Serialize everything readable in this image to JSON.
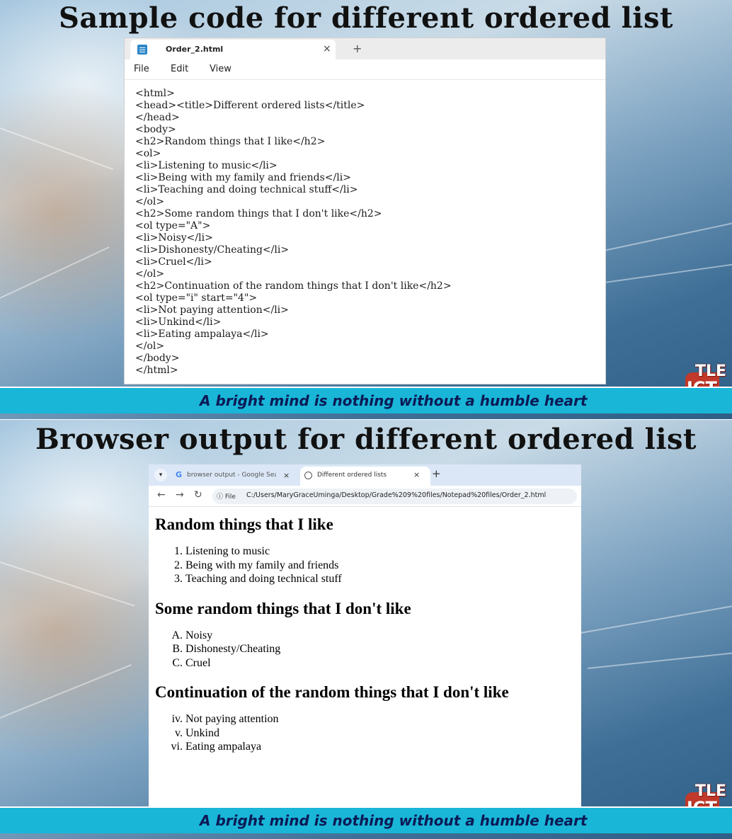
{
  "slide1": {
    "title": "Sample code for different ordered list",
    "footer": "A bright mind is nothing without a humble heart",
    "logo": {
      "top": "TLE",
      "bottom": "ICT"
    },
    "notepad": {
      "tab_title": "Order_2.html",
      "close_symbol": "×",
      "new_tab_symbol": "+",
      "menu": [
        "File",
        "Edit",
        "View"
      ],
      "code_lines": [
        "<html>",
        "<head><title>Different ordered lists</title>",
        "</head>",
        "<body>",
        "<h2>Random things that I like</h2>",
        "<ol>",
        "<li>Listening to music</li>",
        "<li>Being with my family and friends</li>",
        "<li>Teaching and doing technical stuff</li>",
        "</ol>",
        "<h2>Some random things that I don't like</h2>",
        "<ol type=\"A\">",
        "<li>Noisy</li>",
        "<li>Dishonesty/Cheating</li>",
        "<li>Cruel</li>",
        "</ol>",
        "<h2>Continuation of the random things that I don't like</h2>",
        "<ol type=\"i\" start=\"4\">",
        "<li>Not paying attention</li>",
        "<li>Unkind</li>",
        "<li>Eating ampalaya</li>",
        "</ol>",
        "</body>",
        "</html>"
      ]
    }
  },
  "slide2": {
    "title": "Browser output for different ordered list",
    "footer": "A bright mind is nothing without a humble heart",
    "logo": {
      "top": "TLE",
      "bottom": "ICT"
    },
    "browser": {
      "tab1_title": "browser output - Google Searc",
      "tab1_icon": "G",
      "tab2_title": "Different ordered lists",
      "close_symbol": "×",
      "new_tab_symbol": "+",
      "file_chip": "File",
      "url": "C:/Users/MaryGraceUminga/Desktop/Grade%209%20files/Notepad%20files/Order_2.html",
      "page": {
        "h2_1": "Random things that I like",
        "list1": [
          {
            "marker": "1.",
            "text": "Listening to music"
          },
          {
            "marker": "2.",
            "text": "Being with my family and friends"
          },
          {
            "marker": "3.",
            "text": "Teaching and doing technical stuff"
          }
        ],
        "h2_2": "Some random things that I don't like",
        "list2": [
          {
            "marker": "A.",
            "text": "Noisy"
          },
          {
            "marker": "B.",
            "text": "Dishonesty/Cheating"
          },
          {
            "marker": "C.",
            "text": "Cruel"
          }
        ],
        "h2_3": "Continuation of the random things that I don't like",
        "list3": [
          {
            "marker": "iv.",
            "text": "Not paying attention"
          },
          {
            "marker": "v.",
            "text": "Unkind"
          },
          {
            "marker": "vi.",
            "text": "Eating ampalaya"
          }
        ]
      }
    }
  },
  "colors": {
    "footer_bar": "#19b6d8",
    "footer_text": "#0c1a55",
    "logo_badge": "#c0392b",
    "browser_tabbar": "#dbe7f6"
  }
}
